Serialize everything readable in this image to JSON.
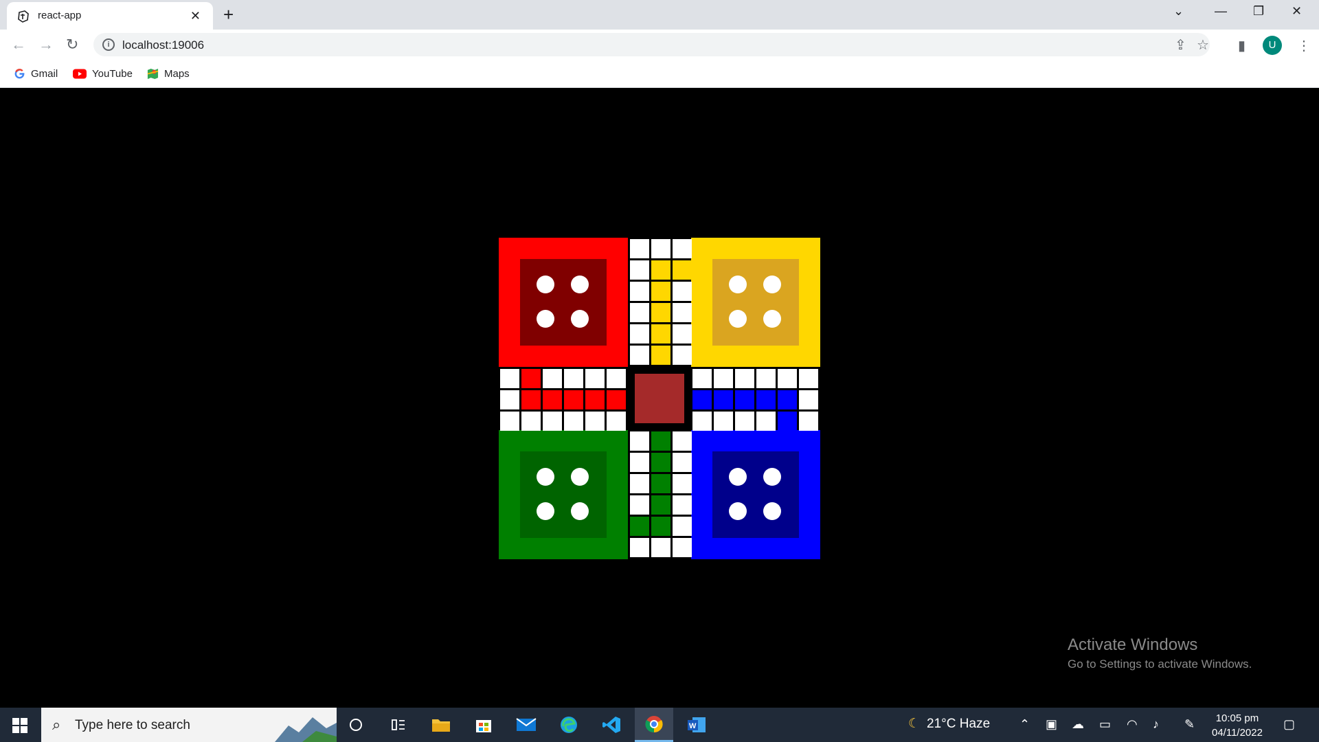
{
  "browser": {
    "tab_title": "react-app",
    "url": "localhost:19006",
    "avatar_letter": "U",
    "bookmarks": [
      {
        "label": "Gmail"
      },
      {
        "label": "YouTube"
      },
      {
        "label": "Maps"
      }
    ]
  },
  "board": {
    "colors": {
      "red": "#ff0000",
      "red_inner": "#800000",
      "yellow": "#ffd700",
      "yellow_inner": "#daa520",
      "green": "#008000",
      "green_inner": "#006400",
      "blue": "#0000ff",
      "blue_inner": "#00008b",
      "center": "#a52a2a"
    }
  },
  "watermark": {
    "title": "Activate Windows",
    "subtitle": "Go to Settings to activate Windows."
  },
  "taskbar": {
    "search_placeholder": "Type here to search",
    "weather": "21°C  Haze",
    "time": "10:05 pm",
    "date": "04/11/2022"
  }
}
